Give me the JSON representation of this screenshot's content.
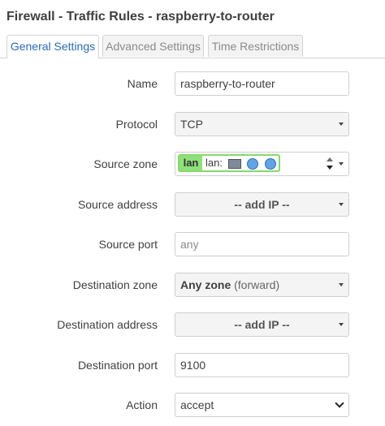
{
  "page": {
    "title": "Firewall - Traffic Rules - raspberry-to-router"
  },
  "tabs": [
    {
      "label": "General Settings"
    },
    {
      "label": "Advanced Settings"
    },
    {
      "label": "Time Restrictions"
    }
  ],
  "form": {
    "name": {
      "label": "Name",
      "value": "raspberry-to-router"
    },
    "protocol": {
      "label": "Protocol",
      "value": "TCP"
    },
    "source_zone": {
      "label": "Source zone",
      "zone": "lan",
      "detail": "lan:"
    },
    "source_address": {
      "label": "Source address",
      "value": "-- add IP --"
    },
    "source_port": {
      "label": "Source port",
      "placeholder": "any"
    },
    "destination_zone": {
      "label": "Destination zone",
      "value": "Any zone",
      "suffix": "(forward)"
    },
    "destination_address": {
      "label": "Destination address",
      "value": "-- add IP --"
    },
    "destination_port": {
      "label": "Destination port",
      "value": "9100"
    },
    "action": {
      "label": "Action",
      "value": "accept"
    }
  },
  "icons": [
    "network-port-icon",
    "globe-icon",
    "globe-icon"
  ],
  "colors": {
    "active_tab": "#2a6bb8",
    "lan_zone": "#8fe07a",
    "lan_border": "#86d96b"
  }
}
